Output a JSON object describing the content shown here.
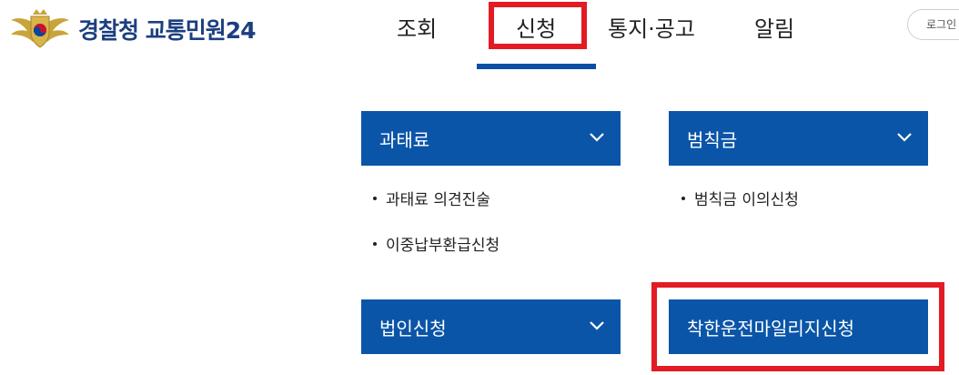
{
  "header": {
    "logo_text": "경찰청 교통민원24",
    "nav": [
      "조회",
      "신청",
      "통지·공고",
      "알림"
    ],
    "active_nav": "신청",
    "login_label": "로그인"
  },
  "categories": [
    {
      "label": "과태료",
      "items": [
        "과태료 의견진술",
        "이중납부환급신청"
      ]
    },
    {
      "label": "범칙금",
      "items": [
        "범칙금 이의신청"
      ]
    },
    {
      "label": "법인신청",
      "items": []
    },
    {
      "label": "착한운전마일리지신청",
      "items": []
    }
  ],
  "colors": {
    "accent": "#0a55a8",
    "logo_text": "#1c3f7f",
    "highlight": "#e31b23"
  },
  "icons": {
    "logo": "police-emblem-icon",
    "expand": "chevron-down-icon"
  }
}
